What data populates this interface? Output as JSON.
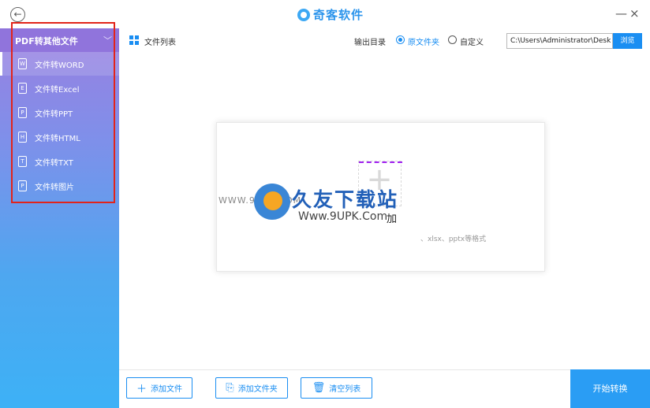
{
  "app": {
    "name": "奇客软件",
    "minimize": "—",
    "close": "×",
    "back": "←"
  },
  "sidebar": {
    "header": "PDF转其他文件",
    "items": [
      {
        "icon_letter": "W",
        "icon": "word-file-icon",
        "label": "文件转WORD"
      },
      {
        "icon_letter": "E",
        "icon": "excel-file-icon",
        "label": "文件转Excel"
      },
      {
        "icon_letter": "P",
        "icon": "ppt-file-icon",
        "label": "文件转PPT"
      },
      {
        "icon_letter": "H",
        "icon": "html-file-icon",
        "label": "文件转HTML"
      },
      {
        "icon_letter": "T",
        "icon": "txt-file-icon",
        "label": "文件转TXT"
      },
      {
        "icon_letter": "P",
        "icon": "image-file-icon",
        "label": "文件转图片"
      }
    ]
  },
  "toolbar": {
    "list_title": "文件列表",
    "output_label": "输出目录",
    "radio_source": "原文件夹",
    "radio_custom": "自定义",
    "path_value": "C:\\Users\\Administrator\\Desk",
    "browse": "浏览"
  },
  "dropzone": {
    "hint": "加",
    "sub": "、xlsx、pptx等格式"
  },
  "watermark": {
    "left": "WWW.9UPK.COM",
    "title": "久友下载站",
    "url": "Www.9UPK.Com"
  },
  "bottom": {
    "add_file": "添加文件",
    "add_folder": "添加文件夹",
    "clear_list": "清空列表",
    "start": "开始转换"
  },
  "colors": {
    "accent": "#1a8ef2",
    "sidebar_top": "#9b7fe0",
    "sidebar_bottom": "#3db1f6",
    "highlight_box": "#e2231a"
  }
}
